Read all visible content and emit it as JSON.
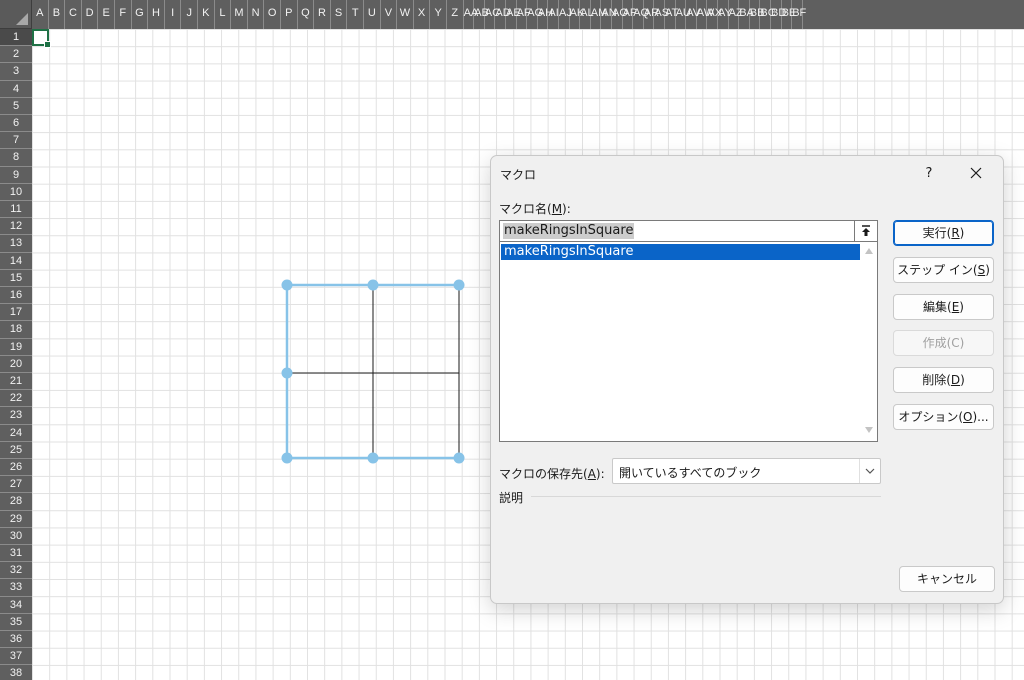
{
  "sheet": {
    "columns": [
      "A",
      "B",
      "C",
      "D",
      "E",
      "F",
      "G",
      "H",
      "I",
      "J",
      "K",
      "L",
      "M",
      "N",
      "O",
      "P",
      "Q",
      "R",
      "S",
      "T",
      "U",
      "V",
      "W",
      "X",
      "Y",
      "Z",
      "AA",
      "AB",
      "AC",
      "AD",
      "AE",
      "AF",
      "AG",
      "AH",
      "AI",
      "AJ",
      "AK",
      "AL",
      "AM",
      "AN",
      "AO",
      "AP",
      "AQ",
      "AR",
      "AS",
      "AT",
      "AU",
      "AV",
      "AW",
      "AX",
      "AY",
      "AZ",
      "BA",
      "BB",
      "BC",
      "BD",
      "BE",
      "BF"
    ],
    "rows": [
      "1",
      "2",
      "3",
      "4",
      "5",
      "6",
      "7",
      "8",
      "9",
      "10",
      "11",
      "12",
      "13",
      "14",
      "15",
      "16",
      "17",
      "18",
      "19",
      "20",
      "21",
      "22",
      "23",
      "24",
      "25",
      "26",
      "27",
      "28",
      "29",
      "30",
      "31",
      "32",
      "33",
      "34",
      "35",
      "36",
      "37",
      "38"
    ],
    "selected_row": "1",
    "shape_line_color": "#87c3e8",
    "shape_inner_line_color": "#1a1a1a"
  },
  "dialog": {
    "title": "マクロ",
    "help": "?",
    "close_icon": "close-icon",
    "name_label_text": "マクロ名(",
    "name_label_key": "M",
    "name_label_end": "):",
    "name_value": "makeRingsInSquare",
    "macros": [
      "makeRingsInSquare"
    ],
    "buttons": {
      "run": {
        "text": "実行(",
        "key": "R",
        "end": ")"
      },
      "step_in": {
        "text": "ステップ イン(",
        "key": "S",
        "end": ")"
      },
      "edit": {
        "text": "編集(",
        "key": "E",
        "end": ")"
      },
      "create": {
        "text": "作成(C)"
      },
      "delete": {
        "text": "削除(",
        "key": "D",
        "end": ")"
      },
      "options": {
        "text": "オプション(",
        "key": "O",
        "end": ")..."
      }
    },
    "store_label_text": "マクロの保存先(",
    "store_label_key": "A",
    "store_label_end": "):",
    "store_value": "開いているすべてのブック",
    "description_label": "説明",
    "cancel": "キャンセル",
    "accent_color": "#0a64c8"
  }
}
